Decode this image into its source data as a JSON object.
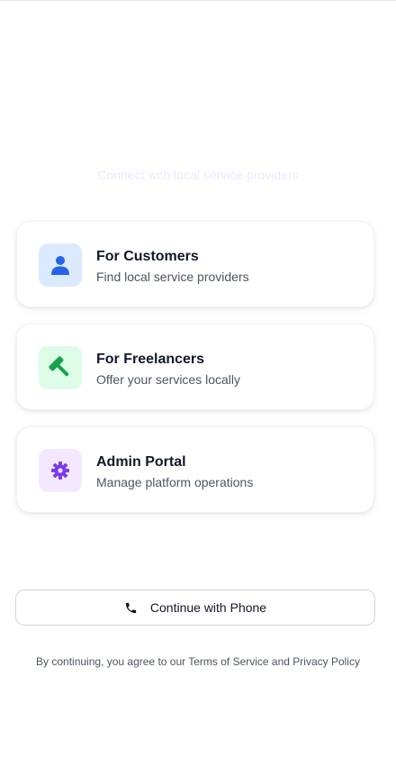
{
  "header": {
    "tagline": "Connect with local service providers"
  },
  "roles": [
    {
      "title": "For Customers",
      "description": "Find local service providers",
      "icon": "user-icon",
      "icon_bg": "#dbeafe",
      "icon_color": "#2563eb"
    },
    {
      "title": "For Freelancers",
      "description": "Offer your services locally",
      "icon": "hammer-icon",
      "icon_bg": "#dcfce7",
      "icon_color": "#16a34a"
    },
    {
      "title": "Admin Portal",
      "description": "Manage platform operations",
      "icon": "gear-icon",
      "icon_bg": "#f3e8ff",
      "icon_color": "#7c3aed"
    }
  ],
  "auth": {
    "phone_button_label": "Continue with Phone",
    "phone_icon": "phone-icon"
  },
  "footer": {
    "legal_text": "By continuing, you agree to our Terms of Service and Privacy Policy"
  },
  "colors": {
    "customer_accent": "#2563eb",
    "freelancer_accent": "#16a34a",
    "admin_accent": "#7c3aed",
    "text_primary": "#111827",
    "text_secondary": "#4b5563"
  }
}
